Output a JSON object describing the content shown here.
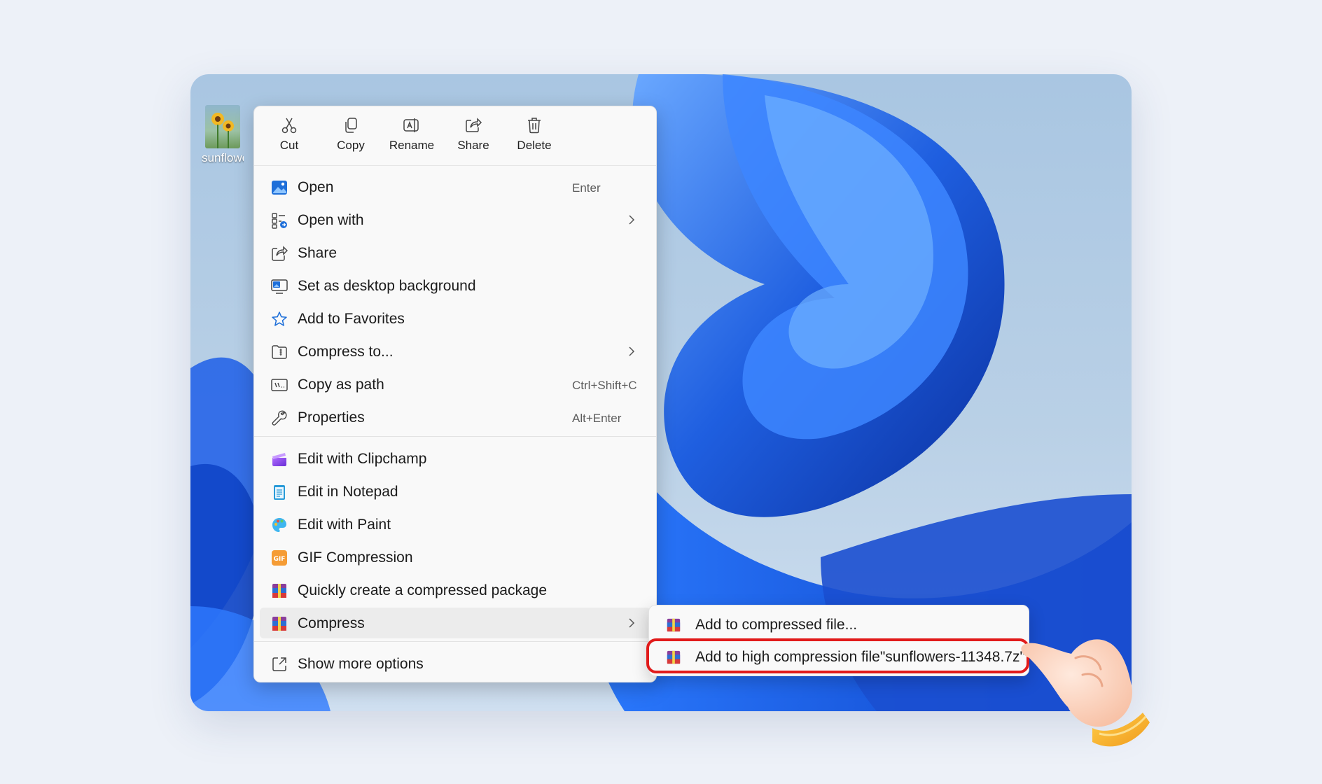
{
  "desktop": {
    "file_label": "sunflowe"
  },
  "toolbar": {
    "cut": "Cut",
    "copy": "Copy",
    "rename": "Rename",
    "share": "Share",
    "delete": "Delete"
  },
  "menu": {
    "items": [
      {
        "label": "Open",
        "shortcut": "Enter",
        "icon": "photos-icon"
      },
      {
        "label": "Open with",
        "icon": "open-with-icon",
        "submenu": true
      },
      {
        "label": "Share",
        "icon": "share-icon"
      },
      {
        "label": "Set as desktop background",
        "icon": "desktop-background-icon"
      },
      {
        "label": "Add to Favorites",
        "icon": "star-icon"
      },
      {
        "label": "Compress to...",
        "icon": "zip-folder-icon",
        "submenu": true
      },
      {
        "label": "Copy as path",
        "shortcut": "Ctrl+Shift+C",
        "icon": "path-icon"
      },
      {
        "label": "Properties",
        "shortcut": "Alt+Enter",
        "icon": "wrench-icon"
      },
      {
        "label": "Edit with Clipchamp",
        "icon": "clipchamp-icon"
      },
      {
        "label": "Edit in Notepad",
        "icon": "notepad-icon"
      },
      {
        "label": "Edit with Paint",
        "icon": "paint-icon"
      },
      {
        "label": "GIF Compression",
        "icon": "gif-icon"
      },
      {
        "label": "Quickly create a compressed package",
        "icon": "archive-icon"
      },
      {
        "label": "Compress",
        "icon": "archive-icon",
        "submenu": true
      },
      {
        "label": "Show more options",
        "icon": "more-options-icon"
      }
    ]
  },
  "submenu": {
    "items": [
      {
        "label": "Add to compressed file..."
      },
      {
        "label": "Add to high compression file\"sunflowers-11348.7z\""
      }
    ]
  },
  "colors": {
    "highlight_ring": "#e11b1b",
    "accent": "#2f6fd6"
  }
}
